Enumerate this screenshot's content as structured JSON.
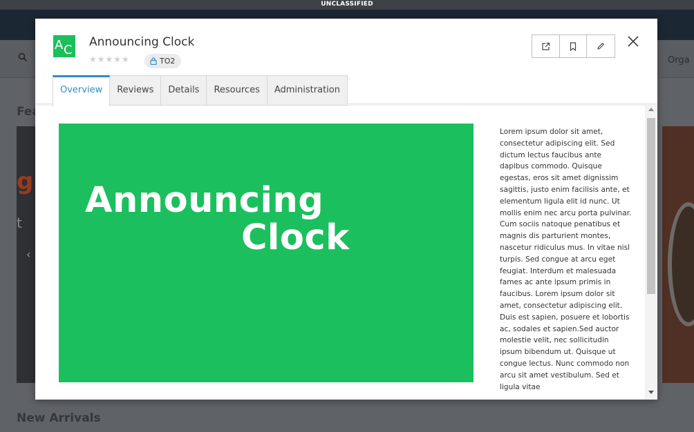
{
  "classification_banner": "UNCLASSIFIED",
  "background": {
    "search_icon": "search-icon",
    "org_label": "Orga",
    "featured_heading": "Fea",
    "carousel_fragment_orange": "g",
    "carousel_fragment_text": "t",
    "new_arrivals_heading": "New Arrivals"
  },
  "modal": {
    "logo": {
      "letter_a": "A",
      "letter_c": "C",
      "color": "#1dbf5c"
    },
    "title": "Announcing Clock",
    "rating": {
      "stars": "★★★★★",
      "value": 0,
      "max": 5
    },
    "badge": {
      "icon": "lock-icon",
      "label": "TO2"
    },
    "toolbar": {
      "open_icon": "external-link-icon",
      "bookmark_icon": "bookmark-icon",
      "edit_icon": "pencil-icon"
    },
    "close_icon": "close-icon",
    "tabs": [
      {
        "label": "Overview",
        "active": true
      },
      {
        "label": "Reviews",
        "active": false
      },
      {
        "label": "Details",
        "active": false
      },
      {
        "label": "Resources",
        "active": false
      },
      {
        "label": "Administration",
        "active": false
      }
    ],
    "hero": {
      "line1": "Announcing",
      "line2": "Clock",
      "color": "#1cbf5d"
    },
    "description": "Lorem ipsum dolor sit amet, consectetur adipiscing elit. Sed dictum lectus faucibus ante dapibus commodo. Quisque egestas, eros sit amet dignissim sagittis, justo enim facilisis ante, et elementum ligula elit id nunc. Ut mollis enim nec arcu porta pulvinar. Cum sociis natoque penatibus et magnis dis parturient montes, nascetur ridiculus mus. In vitae nisl turpis. Sed congue at arcu eget feugiat. Interdum et malesuada fames ac ante ipsum primis in faucibus. Lorem ipsum dolor sit amet, consectetur adipiscing elit. Duis est sapien, posuere et lobortis ac, sodales et sapien.Sed auctor molestie velit, nec sollicitudin ipsum bibendum ut. Quisque ut congue lectus. Nunc commodo non arcu sit amet vestibulum. Sed et ligula vitae"
  },
  "colors": {
    "accent": "#2d8cc8",
    "brand_green": "#1cbf5d"
  }
}
